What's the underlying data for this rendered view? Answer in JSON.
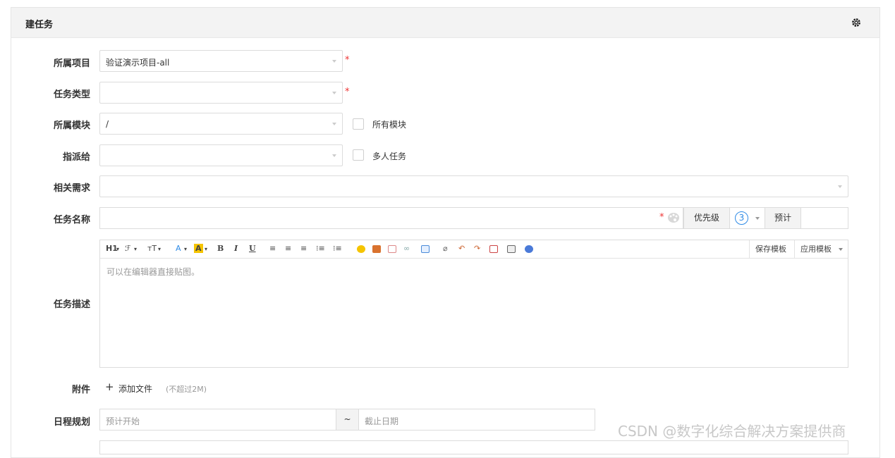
{
  "panel": {
    "title": "建任务"
  },
  "form": {
    "project": {
      "label": "所属项目",
      "value": "验证演示项目-all",
      "required": "*"
    },
    "type": {
      "label": "任务类型",
      "value": "",
      "required": "*"
    },
    "module": {
      "label": "所属模块",
      "value": "/",
      "checkbox_label": "所有模块"
    },
    "assign": {
      "label": "指派给",
      "value": "",
      "checkbox_label": "多人任务"
    },
    "story": {
      "label": "相关需求",
      "value": ""
    },
    "name": {
      "label": "任务名称",
      "required": "*",
      "priority_label": "优先级",
      "priority_value": "3",
      "estimate_label": "预计"
    },
    "desc": {
      "label": "任务描述",
      "placeholder": "可以在编辑器直接贴图。",
      "toolbar": {
        "h1": "H1",
        "font": "ℱ",
        "size": "тT",
        "fontcolor": "A",
        "bgcolor": "A",
        "bold": "B",
        "italic": "I",
        "underline": "U",
        "save_template": "保存模板",
        "apply_template": "应用模板"
      }
    },
    "files": {
      "label": "附件",
      "add": "添加文件",
      "hint": "(不超过2M)"
    },
    "schedule": {
      "label": "日程规划",
      "start_placeholder": "预计开始",
      "separator": "~",
      "end_placeholder": "截止日期"
    }
  },
  "watermark": "CSDN @数字化综合解决方案提供商",
  "colors": {
    "required": "#e33333",
    "accent": "#2f8be6",
    "header_bg": "#f3f3f3"
  }
}
